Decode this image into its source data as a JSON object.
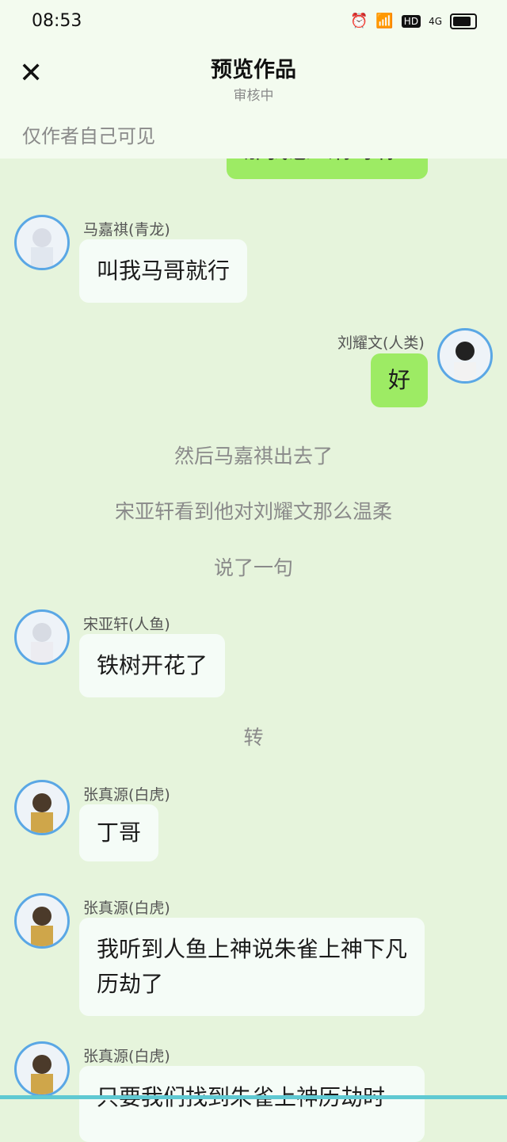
{
  "status_bar": {
    "time": "08:53",
    "battery_icon": "battery-icon",
    "signal_label": "4G",
    "hd_label": "HD"
  },
  "header": {
    "title": "预览作品",
    "subtitle": "审核中",
    "visibility": "仅作者自己可见"
  },
  "partial_top_bubble": "那我怎么称呼你",
  "messages": [
    {
      "name": "马嘉祺(青龙)",
      "text": "叫我马哥就行"
    },
    {
      "name": "刘耀文(人类)",
      "text": "好"
    },
    {
      "narration": "然后马嘉祺出去了"
    },
    {
      "narration": "宋亚轩看到他对刘耀文那么温柔"
    },
    {
      "narration": "说了一句"
    },
    {
      "name": "宋亚轩(人鱼)",
      "text": "铁树开花了"
    },
    {
      "narration": "转"
    },
    {
      "name": "张真源(白虎)",
      "text": "丁哥"
    },
    {
      "name": "张真源(白虎)",
      "text": "我听到人鱼上神说朱雀上神下凡历劫了"
    },
    {
      "name": "张真源(白虎)",
      "text": "只要我们找到朱雀上神历劫时"
    }
  ]
}
